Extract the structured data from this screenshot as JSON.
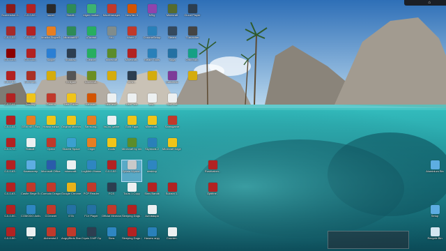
{
  "desktop": {
    "icons": [
      {
        "label": "Screenshot 0..",
        "c": 1,
        "r": 1,
        "color": "#8b1a1a"
      },
      {
        "label": "0-0-0-52..",
        "c": 2,
        "r": 1,
        "color": "#b22222"
      },
      {
        "label": "ssnet",
        "c": 3,
        "r": 1,
        "color": "#2a2a2a"
      },
      {
        "label": "Skedit..",
        "c": 4,
        "r": 1,
        "color": "#2e8b57"
      },
      {
        "label": "eigen motion",
        "c": 5,
        "r": 1,
        "color": "#3cb371"
      },
      {
        "label": "MindManager",
        "c": 6,
        "r": 1,
        "color": "#c0392b"
      },
      {
        "label": "NewTab 3",
        "c": 7,
        "r": 1,
        "color": "#d35400"
      },
      {
        "label": "NSig",
        "c": 8,
        "r": 1,
        "color": "#8e44ad"
      },
      {
        "label": "Minecraft",
        "c": 9,
        "r": 1,
        "color": "#556b2f"
      },
      {
        "label": "Cloud Player",
        "c": 10,
        "r": 1,
        "color": "#2c3e50"
      },
      {
        "label": "0-0-0-32..",
        "c": 1,
        "r": 2,
        "color": "#a52a2a"
      },
      {
        "label": "0-0-0-48..",
        "c": 2,
        "r": 2,
        "color": "#b22222"
      },
      {
        "label": "Mozilla SkypeSetup",
        "c": 3,
        "r": 2,
        "color": "#e67e22"
      },
      {
        "label": "MinecraftSP",
        "c": 4,
        "r": 2,
        "color": "#2e8b57"
      },
      {
        "label": "uTorrent",
        "c": 5,
        "r": 2,
        "color": "#27ae60"
      },
      {
        "label": "SKL",
        "c": 6,
        "r": 2,
        "color": "#7f8c8d"
      },
      {
        "label": "World 2",
        "c": 7,
        "r": 2,
        "color": "#c0392b"
      },
      {
        "label": "ChromeSetup",
        "c": 8,
        "r": 2,
        "color": "#2980b9"
      },
      {
        "label": "Steam",
        "c": 9,
        "r": 2,
        "color": "#34495e"
      },
      {
        "label": "TLauncher",
        "c": 10,
        "r": 2,
        "color": "#444"
      },
      {
        "label": "0-0-0-23..",
        "c": 1,
        "r": 3,
        "color": "#8b0000"
      },
      {
        "label": "0-0-0-32..",
        "c": 2,
        "r": 3,
        "color": "#b22222"
      },
      {
        "label": "Skype",
        "c": 3,
        "r": 3,
        "color": "#2a7fd4"
      },
      {
        "label": "Shadow..",
        "c": 4,
        "r": 3,
        "color": "#2c3e50"
      },
      {
        "label": "Cleaner",
        "c": 5,
        "r": 3,
        "color": "#27ae60"
      },
      {
        "label": "minecraft",
        "c": 6,
        "r": 3,
        "color": "#5b8c2a"
      },
      {
        "label": "Minecraft..",
        "c": 7,
        "r": 3,
        "color": "#b22222"
      },
      {
        "label": "Steam Tools",
        "c": 8,
        "r": 3,
        "color": "#2980b9"
      },
      {
        "label": "Soga",
        "c": 9,
        "r": 3,
        "color": "#2471a3"
      },
      {
        "label": "Orbit Edit..",
        "c": 10,
        "r": 3,
        "color": "#16a085"
      },
      {
        "label": "0-0-0-52..",
        "c": 1,
        "r": 4,
        "color": "#b22222"
      },
      {
        "label": "0-0-0-49..",
        "c": 2,
        "r": 4,
        "color": "#a93226"
      },
      {
        "label": "",
        "c": 3,
        "r": 4,
        "color": "#d4ac0d"
      },
      {
        "label": "Hellgate",
        "c": 4,
        "r": 4,
        "color": "#555"
      },
      {
        "label": "Minecraft..",
        "c": 5,
        "r": 4,
        "color": "#6b8e23"
      },
      {
        "label": "",
        "c": 6,
        "r": 4,
        "color": "#d4ac0d"
      },
      {
        "label": "ldmirr..",
        "c": 7,
        "r": 4,
        "color": "#2c3e50"
      },
      {
        "label": "",
        "c": 8,
        "r": 4,
        "color": "#d4ac0d"
      },
      {
        "label": "Battlefield",
        "c": 9,
        "r": 4,
        "color": "#7d3c98"
      },
      {
        "label": "",
        "c": 10,
        "r": 4,
        "color": "#d4ac0d"
      },
      {
        "label": "0-0-0-44..",
        "c": 1,
        "r": 5,
        "color": "#b22222"
      },
      {
        "label": "Desktop",
        "c": 2,
        "r": 5,
        "color": "#f0c419"
      },
      {
        "label": "Garena",
        "c": 3,
        "r": 5,
        "color": "#c0392b"
      },
      {
        "label": "New Folder",
        "c": 4,
        "r": 5,
        "color": "#f0c419"
      },
      {
        "label": "Hamster..",
        "c": 5,
        "r": 5,
        "color": "#d35400"
      },
      {
        "label": "new text..",
        "c": 6,
        "r": 5,
        "color": "#ecf0f1"
      },
      {
        "label": "New Text",
        "c": 7,
        "r": 5,
        "color": "#ecf0f1"
      },
      {
        "label": "test..",
        "c": 8,
        "r": 5,
        "color": "#ecf0f1"
      },
      {
        "label": "Half-Life",
        "c": 9,
        "r": 5,
        "color": "#ecf0f1"
      },
      {
        "label": "0-0-0-44..",
        "c": 1,
        "r": 6,
        "color": "#b22222"
      },
      {
        "label": "GSM NET Rus",
        "c": 2,
        "r": 6,
        "color": "#e67e22"
      },
      {
        "label": "Новая папка",
        "c": 3,
        "r": 6,
        "color": "#f0c419"
      },
      {
        "label": "Original Minecraft..",
        "c": 4,
        "r": 6,
        "color": "#f0c419"
      },
      {
        "label": "Samsung..",
        "c": 5,
        "r": 6,
        "color": "#e67e22"
      },
      {
        "label": "hsi-ss_game",
        "c": 6,
        "r": 6,
        "color": "#ecf0f1"
      },
      {
        "label": "Gold Eggs",
        "c": 7,
        "r": 6,
        "color": "#f0c419"
      },
      {
        "label": "Minecraft..",
        "c": 8,
        "r": 6,
        "color": "#f0c419"
      },
      {
        "label": "Samsgame",
        "c": 9,
        "r": 6,
        "color": "#c0392b"
      },
      {
        "label": "0-0-0-72..",
        "c": 1,
        "r": 7,
        "color": "#b22222"
      },
      {
        "label": "Новый..",
        "c": 2,
        "r": 7,
        "color": "#ecf0f1"
      },
      {
        "label": "Opera",
        "c": 3,
        "r": 7,
        "color": "#c0392b"
      },
      {
        "label": "Shared Space",
        "c": 4,
        "r": 7,
        "color": "#3aa0d0"
      },
      {
        "label": "Origin",
        "c": 5,
        "r": 7,
        "color": "#e67e22"
      },
      {
        "label": "mods",
        "c": 6,
        "r": 7,
        "color": "#f0c419"
      },
      {
        "label": "Minecraft by minecraft",
        "c": 7,
        "r": 7,
        "color": "#5b8c2a"
      },
      {
        "label": "Skymods 2",
        "c": 8,
        "r": 7,
        "color": "#2980b9"
      },
      {
        "label": "Minecraft forge 1.6.2",
        "c": 9,
        "r": 7,
        "color": "#f0c419"
      },
      {
        "label": "0-0-0-63..",
        "c": 1,
        "r": 8,
        "color": "#b22222"
      },
      {
        "label": "Компьютер",
        "c": 2,
        "r": 8,
        "color": "#5dade2"
      },
      {
        "label": "Microsoft Office Wor..",
        "c": 3,
        "r": 8,
        "color": "#2a5caa"
      },
      {
        "label": "minecraft..",
        "c": 4,
        "r": 8,
        "color": "#ecf0f1"
      },
      {
        "label": "LogMeIn Hamachi",
        "c": 5,
        "r": 8,
        "color": "#2e86c1"
      },
      {
        "label": "0-0-0-52..",
        "c": 6,
        "r": 8,
        "color": "#b22222"
      },
      {
        "label": "Oplata Wynne..",
        "c": 7,
        "r": 8,
        "color": "#c9c9c9",
        "hl": true
      },
      {
        "label": "desktop",
        "c": 8,
        "r": 8,
        "color": "#2e86c1"
      },
      {
        "label": "Rushkalom..",
        "c": 11,
        "r": 8,
        "color": "#b22222"
      },
      {
        "label": "0-0-0-63..",
        "c": 1,
        "r": 9,
        "color": "#b22222"
      },
      {
        "label": "Castle Siege Ed..",
        "c": 2,
        "r": 9,
        "color": "#c0392b"
      },
      {
        "label": "Comodo Dragon",
        "c": 3,
        "r": 9,
        "color": "#c0392b"
      },
      {
        "label": "Google Chrome",
        "c": 4,
        "r": 9,
        "color": "#e8b21a"
      },
      {
        "label": "PCP Reader",
        "c": 5,
        "r": 9,
        "color": "#c0392b"
      },
      {
        "label": "FCS",
        "c": 6,
        "r": 9,
        "color": "#2c3e50"
      },
      {
        "label": "Tours 1 Copy",
        "c": 7,
        "r": 9,
        "color": "#ecf0f1"
      },
      {
        "label": "Sims Bandit",
        "c": 8,
        "r": 9,
        "color": "#b22222"
      },
      {
        "label": "Suloshi 1..",
        "c": 9,
        "r": 9,
        "color": "#b22222"
      },
      {
        "label": "Optifine..",
        "c": 11,
        "r": 9,
        "color": "#b22222"
      },
      {
        "label": "0-0-0-50..",
        "c": 1,
        "r": 10,
        "color": "#b22222"
      },
      {
        "label": "COMODO Antivirus",
        "c": 2,
        "r": 10,
        "color": "#2e86c1"
      },
      {
        "label": "CCleaner",
        "c": 3,
        "r": 10,
        "color": "#c0392b"
      },
      {
        "label": "GTA",
        "c": 4,
        "r": 10,
        "color": "#2471a3"
      },
      {
        "label": "FLV Player",
        "c": 5,
        "r": 10,
        "color": "#2471a3"
      },
      {
        "label": "Official Minecraft",
        "c": 6,
        "r": 10,
        "color": "#c0392b"
      },
      {
        "label": "Sleeping Dogs 1",
        "c": 7,
        "r": 10,
        "color": "#b22222"
      },
      {
        "label": "Активация",
        "c": 8,
        "r": 10,
        "color": "#ecf0f1"
      },
      {
        "label": "0-0-0-50..",
        "c": 1,
        "r": 11,
        "color": "#b22222"
      },
      {
        "label": "Hal",
        "c": 2,
        "r": 11,
        "color": "#ecf0f1"
      },
      {
        "label": "Alchemist 2",
        "c": 3,
        "r": 11,
        "color": "#c0392b"
      },
      {
        "label": "AngryBirds StarWars",
        "c": 4,
        "r": 11,
        "color": "#c0392b"
      },
      {
        "label": "Crysis 3 MP Open Beta",
        "c": 5,
        "r": 11,
        "color": "#2c3e50"
      },
      {
        "label": "Sims",
        "c": 6,
        "r": 11,
        "color": "#2e86c1"
      },
      {
        "label": "Sleeping Dogs 2",
        "c": 7,
        "r": 11,
        "color": "#b22222"
      },
      {
        "label": "Начать игру",
        "c": 8,
        "r": 11,
        "color": "#2980b9"
      },
      {
        "label": "Counter..",
        "c": 9,
        "r": 11,
        "color": "#ecf0f1"
      }
    ],
    "right_icons": [
      {
        "label": "Aluminium Bin",
        "row": 8,
        "color": "#5dade2"
      },
      {
        "label": "Setup",
        "row": 10,
        "color": "#5dade2"
      },
      {
        "label": "Recycle Bin",
        "row": 11,
        "color": "#d4e6f1"
      }
    ]
  },
  "wallpaper": {
    "sky_top": "#3f7fc2",
    "sky_bottom": "#bcd9ef",
    "water_top": "#2fb5b8",
    "water_bottom": "#0f5b66",
    "rock": "#9a958d"
  }
}
